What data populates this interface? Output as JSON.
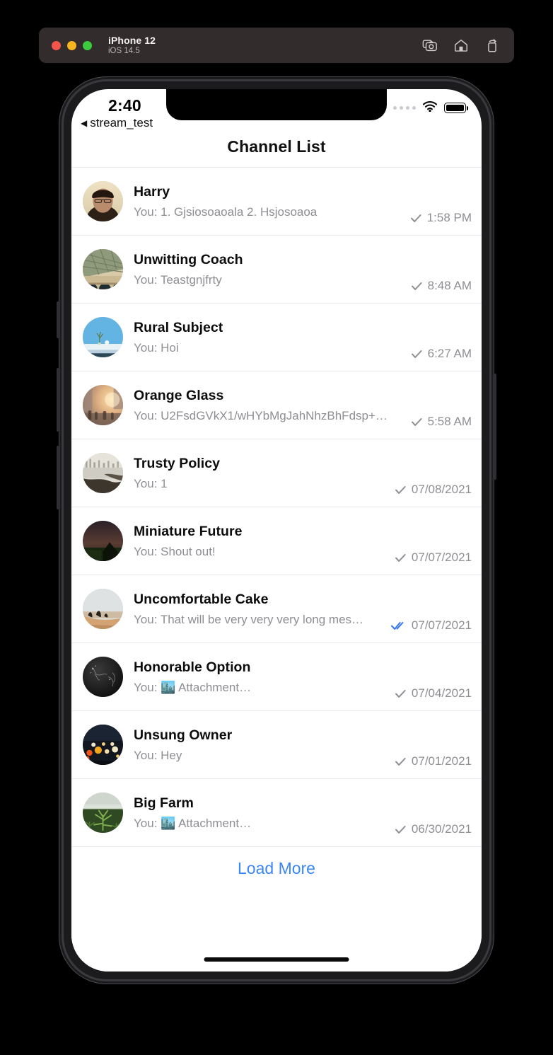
{
  "simulator": {
    "device_name": "iPhone 12",
    "os_version": "iOS 14.5",
    "window_icons": [
      "screenshot-icon",
      "home-icon",
      "rotate-icon"
    ]
  },
  "status_bar": {
    "time": "2:40",
    "back_caret": "◀",
    "back_label": "stream_test",
    "cellular_icon": "cellular-dots-icon",
    "wifi_icon": "wifi-icon",
    "battery_icon": "battery-full-icon"
  },
  "navbar": {
    "title": "Channel List"
  },
  "channels": [
    {
      "name": "Harry",
      "preview": "You: 1. Gjsiosoaoala 2. Hsjosoaoa",
      "timestamp": "1:58 PM",
      "read_state": "delivered",
      "avatar": "portrait-man-avatar"
    },
    {
      "name": "Unwitting Coach",
      "preview": "You: Teastgnjfrty",
      "timestamp": "8:48 AM",
      "read_state": "delivered",
      "avatar": "stadium-roof-avatar"
    },
    {
      "name": "Rural Subject",
      "preview": "You: Hoi",
      "timestamp": "6:27 AM",
      "read_state": "delivered",
      "avatar": "blue-sky-snow-avatar"
    },
    {
      "name": "Orange Glass",
      "preview": "You: U2FsdGVkX1/wHYbMgJahNhzBhFdsp+…",
      "timestamp": "5:58 AM",
      "read_state": "delivered",
      "avatar": "sunlit-street-avatar"
    },
    {
      "name": "Trusty Policy",
      "preview": "You: 1",
      "timestamp": "07/08/2021",
      "read_state": "delivered",
      "avatar": "foggy-shoreline-avatar"
    },
    {
      "name": "Miniature Future",
      "preview": "You: Shout out!",
      "timestamp": "07/07/2021",
      "read_state": "delivered",
      "avatar": "dark-field-barn-avatar"
    },
    {
      "name": "Uncomfortable Cake",
      "preview": "You: That will be very very very long mes…",
      "timestamp": "07/07/2021",
      "read_state": "read",
      "avatar": "desert-dunes-avatar"
    },
    {
      "name": "Honorable Option",
      "preview": "You: 🏙️ Attachment…",
      "timestamp": "07/04/2021",
      "read_state": "delivered",
      "avatar": "dark-smoke-avatar"
    },
    {
      "name": "Unsung Owner",
      "preview": "You: Hey",
      "timestamp": "07/01/2021",
      "read_state": "delivered",
      "avatar": "bokeh-lights-avatar"
    },
    {
      "name": "Big Farm",
      "preview": "You: 🏙️ Attachment…",
      "timestamp": "06/30/2021",
      "read_state": "delivered",
      "avatar": "green-plants-avatar"
    }
  ],
  "footer": {
    "load_more_label": "Load More"
  },
  "colors": {
    "accent_blue": "#3b86f7",
    "read_tick_blue": "#3478f6",
    "secondary_text": "#8e8e93",
    "separator": "#e8e8ea",
    "titlebar_bg": "#322c2c"
  }
}
